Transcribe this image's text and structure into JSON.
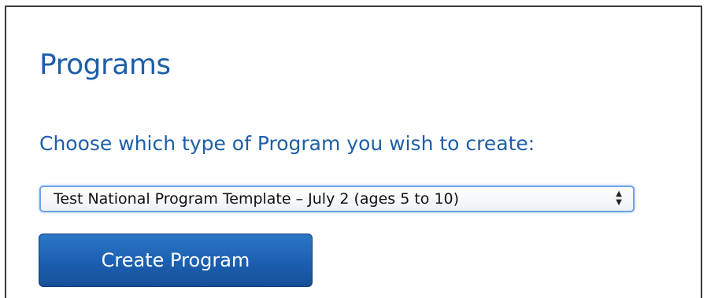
{
  "page": {
    "title": "Programs",
    "prompt": "Choose which type of Program you wish to create:"
  },
  "program_select": {
    "selected": "Test National Program Template – July 2 (ages 5 to 10)",
    "arrow_icon": "up-down-chevron-icon"
  },
  "actions": {
    "create_label": "Create Program"
  },
  "colors": {
    "heading": "#1d5fa8",
    "button": "#1c5fb0",
    "focus_ring": "#6fa3e0"
  }
}
